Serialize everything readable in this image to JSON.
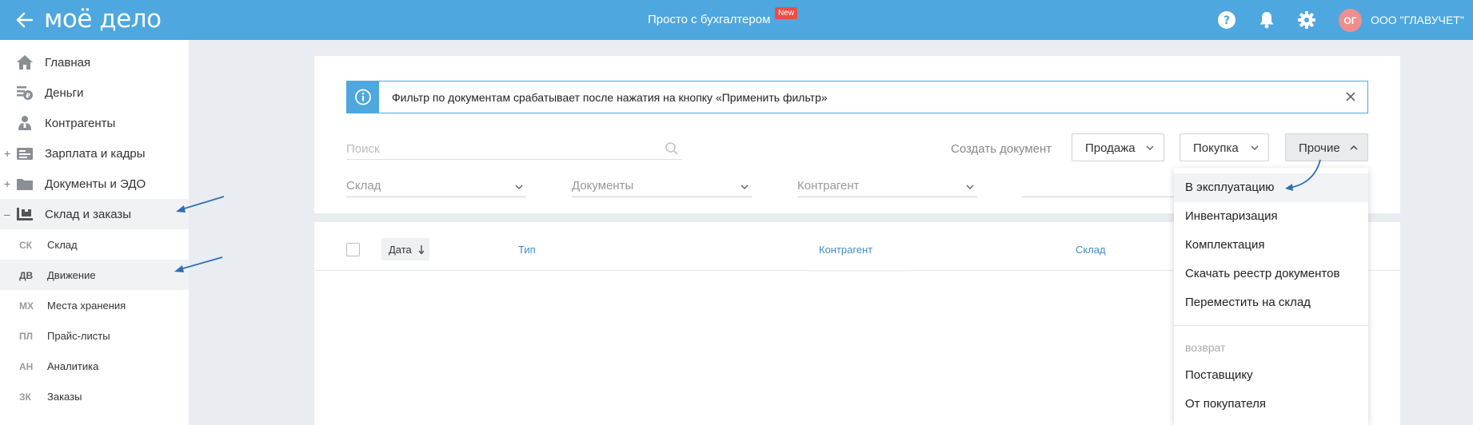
{
  "header": {
    "logo": "моё дело",
    "center_title": "Просто с бухгалтером",
    "new_badge": "New",
    "avatar_initials": "ОГ",
    "org_name": "ООО \"ГЛАВУЧЕТ\""
  },
  "sidebar": {
    "items": [
      {
        "label": "Главная",
        "icon": "home-icon"
      },
      {
        "label": "Деньги",
        "icon": "money-icon"
      },
      {
        "label": "Контрагенты",
        "icon": "contractors-icon"
      },
      {
        "label": "Зарплата и кадры",
        "icon": "salary-icon",
        "expander": "+"
      },
      {
        "label": "Документы и ЭДО",
        "icon": "documents-icon",
        "expander": "+"
      },
      {
        "label": "Склад и заказы",
        "icon": "warehouse-icon",
        "expander": "–"
      }
    ],
    "subitems": [
      {
        "abbr": "СК",
        "label": "Склад"
      },
      {
        "abbr": "ДВ",
        "label": "Движение"
      },
      {
        "abbr": "МХ",
        "label": "Места хранения"
      },
      {
        "abbr": "ПЛ",
        "label": "Прайс-листы"
      },
      {
        "abbr": "АН",
        "label": "Аналитика"
      },
      {
        "abbr": "ЗК",
        "label": "Заказы"
      }
    ]
  },
  "filter": {
    "info_text": "Фильтр по документам срабатывает после нажатия на кнопку «Применить фильтр»",
    "search_placeholder": "Поиск",
    "search_value": "",
    "create_label": "Создать документ",
    "buttons": {
      "sale": "Продажа",
      "purchase": "Покупка",
      "other": "Прочие"
    },
    "selects": {
      "warehouse": "Склад",
      "documents": "Документы",
      "contractor": "Контрагент"
    }
  },
  "table": {
    "columns": {
      "date": "Дата",
      "type": "Тип",
      "contractor": "Контрагент",
      "warehouse": "Склад"
    }
  },
  "menu": {
    "items": [
      "В эксплуатацию",
      "Инвентаризация",
      "Комплектация",
      "Скачать реестр документов",
      "Переместить на склад"
    ],
    "group_label": "возврат",
    "group_items": [
      "Поставщику",
      "От покупателя"
    ]
  },
  "colors": {
    "header_blue": "#4ea7de",
    "link_blue": "#3f8fc7",
    "badge_red": "#ec4c47",
    "avatar_pink": "#ee8f8e",
    "annotation_blue": "#2f6fb4"
  }
}
